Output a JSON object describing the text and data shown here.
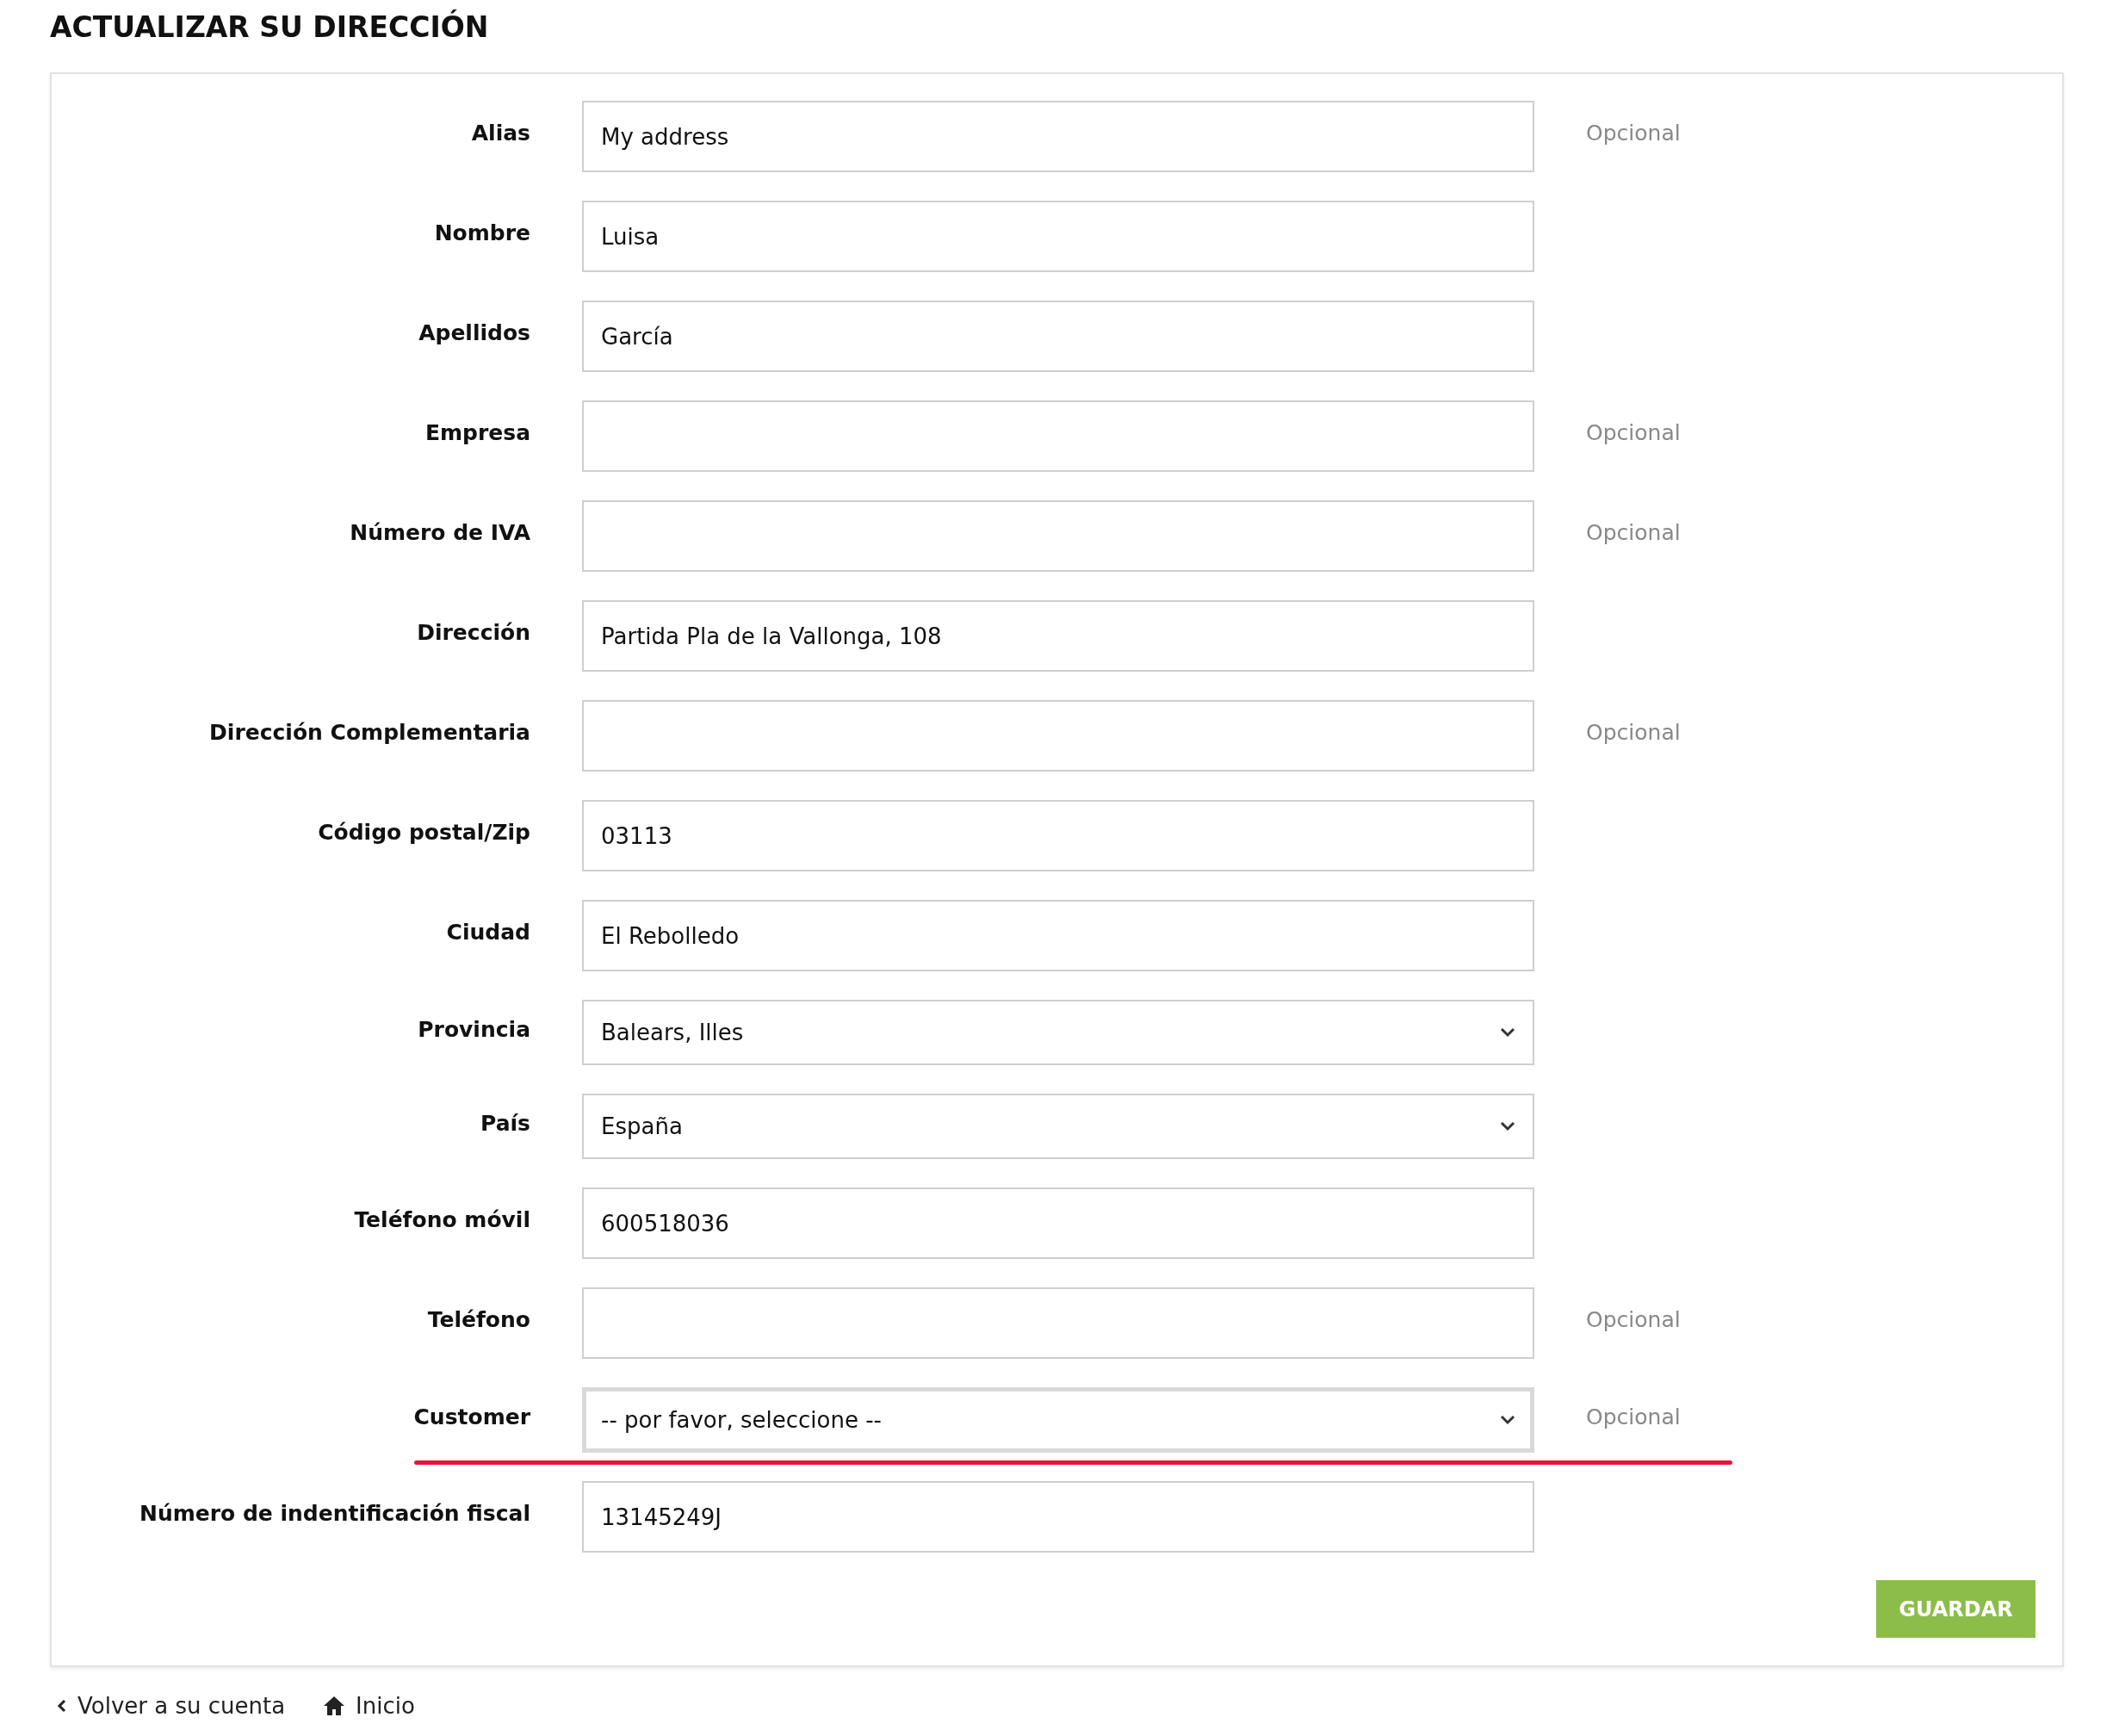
{
  "title": "ACTUALIZAR SU DIRECCIÓN",
  "fields": [
    {
      "label": "Alias",
      "kind": "text",
      "value": "My address",
      "note": "Opcional"
    },
    {
      "label": "Nombre",
      "kind": "text",
      "value": "Luisa"
    },
    {
      "label": "Apellidos",
      "kind": "text",
      "value": "García"
    },
    {
      "label": "Empresa",
      "kind": "text",
      "note": "Opcional"
    },
    {
      "label": "Número de IVA",
      "kind": "text",
      "note": "Opcional"
    },
    {
      "label": "Dirección",
      "kind": "text",
      "value": "Partida Pla de la Vallonga, 108"
    },
    {
      "label": "Dirección Complementaria",
      "kind": "text",
      "note": "Opcional"
    },
    {
      "label": "Código postal/Zip",
      "kind": "text",
      "value": "03113"
    },
    {
      "label": "Ciudad",
      "kind": "text",
      "value": "El Rebolledo"
    },
    {
      "label": "Provincia",
      "kind": "select",
      "value": "Balears, Illes"
    },
    {
      "label": "País",
      "kind": "select",
      "value": "España"
    },
    {
      "label": "Teléfono móvil",
      "kind": "text",
      "value": "600518036"
    },
    {
      "label": "Teléfono",
      "kind": "text",
      "note": "Opcional"
    },
    {
      "label": "Customer",
      "kind": "select",
      "value": "-- por favor, seleccione --",
      "note": "Opcional",
      "focused": true,
      "underlined": true
    },
    {
      "label": "Número de indentificación fiscal",
      "kind": "text",
      "value": "13145249J"
    }
  ],
  "save_button": "GUARDAR",
  "footer_links": [
    {
      "kind": "back",
      "label": "Volver a su cuenta"
    },
    {
      "kind": "home",
      "label": "Inicio"
    }
  ]
}
